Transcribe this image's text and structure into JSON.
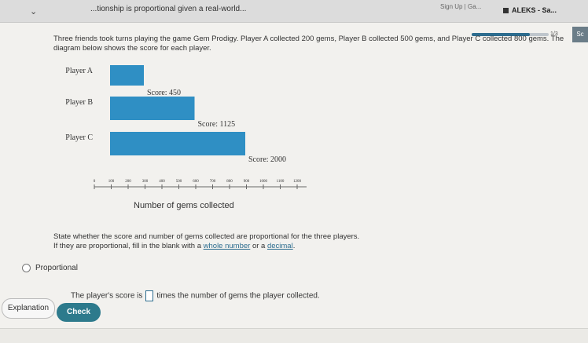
{
  "browser": {
    "tab_title": "...tionship is proportional given a real-world...",
    "top_link": "Sign Up | Ga...",
    "aleks_tab": "ALEKS - Sa..."
  },
  "progress": {
    "label": "1/3",
    "fraction": 0.75
  },
  "side_button": "Sc",
  "question": {
    "prompt": "Three friends took turns playing the game Gem Prodigy. Player A collected 200 gems, Player B collected 500 gems, and Player C collected 800 gems. The diagram below shows the score for each player."
  },
  "chart_data": {
    "type": "bar",
    "orientation": "horizontal",
    "categories": [
      "Player A",
      "Player B",
      "Player C"
    ],
    "values": [
      200,
      500,
      800
    ],
    "score_labels": [
      "Score: 450",
      "Score: 1125",
      "Score: 2000"
    ],
    "xlabel": "Number of gems collected",
    "xlim": [
      0,
      1200
    ],
    "ticks": [
      "0",
      "100",
      "200",
      "300",
      "400",
      "500",
      "600",
      "700",
      "800",
      "900",
      "1000",
      "1100",
      "1200"
    ],
    "bar_color": "#2f8fc4"
  },
  "instructions": {
    "line1": "State whether the score and number of gems collected are proportional for the three players.",
    "line2_prefix": "If they are proportional, fill in the blank with a ",
    "link1": "whole number",
    "middle": " or a ",
    "link2": "decimal",
    "end": "."
  },
  "option": {
    "label": "Proportional"
  },
  "answer": {
    "prefix": "The player's score is",
    "suffix": "times the number of gems the player collected."
  },
  "buttons": {
    "explanation": "Explanation",
    "check": "Check"
  }
}
